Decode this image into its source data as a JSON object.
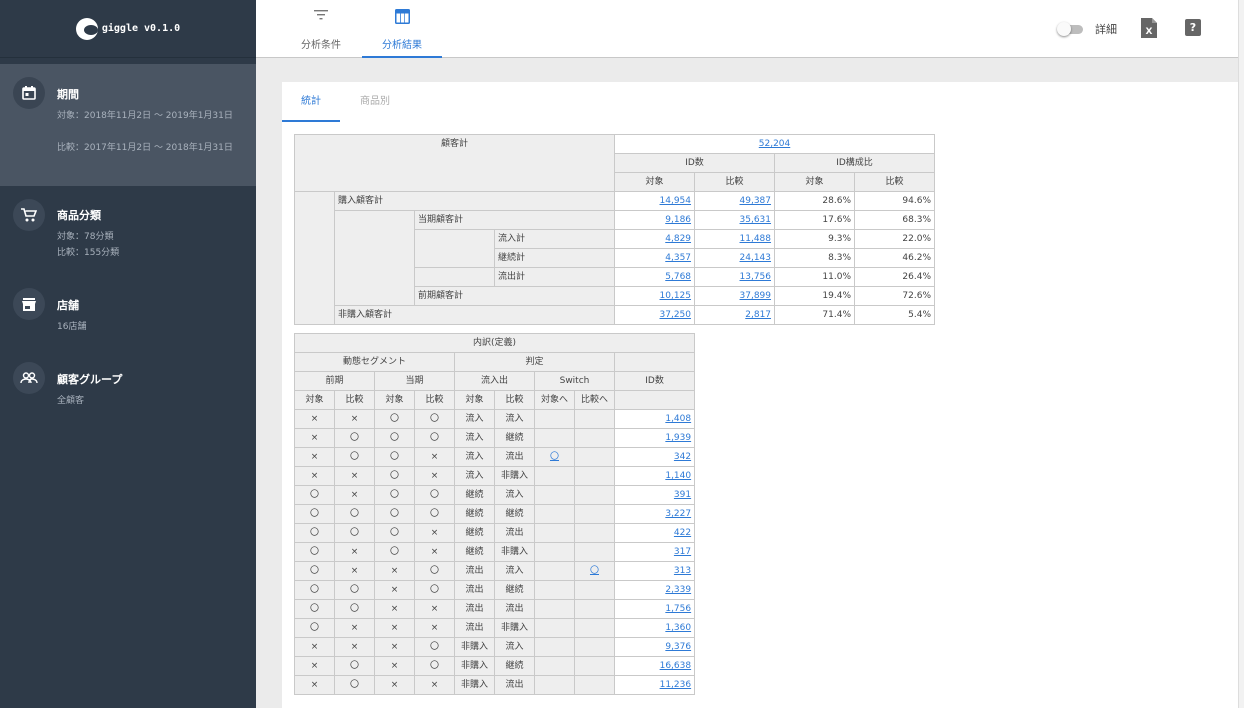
{
  "app": {
    "name": "giggle v0.1.0"
  },
  "sidebar": {
    "items": [
      {
        "title": "期間",
        "lines": [
          "対象：2018年11月2日 ～ 2019年1月31日",
          "比較：2017年11月2日 ～ 2018年1月31日"
        ]
      },
      {
        "title": "商品分類",
        "lines": [
          "対象：78分類",
          "比較：155分類"
        ]
      },
      {
        "title": "店舗",
        "lines": [
          "16店舗"
        ]
      },
      {
        "title": "顧客グループ",
        "lines": [
          "全顧客"
        ]
      }
    ]
  },
  "topbar": {
    "tabs": [
      {
        "label": "分析条件",
        "icon": "filter-icon"
      },
      {
        "label": "分析結果",
        "icon": "table-icon"
      }
    ],
    "active_tab": "分析結果",
    "detail_label": "詳細",
    "help_label": "?"
  },
  "content_tabs": [
    "統計",
    "商品別"
  ],
  "summary": {
    "total_label": "顧客計",
    "total_value": "52,204",
    "id_count_header": "ID数",
    "id_ratio_header": "ID構成比",
    "sub_headers": [
      "対象",
      "比較",
      "対象",
      "比較"
    ],
    "rows": [
      {
        "label": "購入顧客計",
        "target": "14,954",
        "compare": "49,387",
        "target_ratio": "28.6%",
        "compare_ratio": "94.6%"
      },
      {
        "label": "当期顧客計",
        "target": "9,186",
        "compare": "35,631",
        "target_ratio": "17.6%",
        "compare_ratio": "68.3%"
      },
      {
        "label": "流入計",
        "target": "4,829",
        "compare": "11,488",
        "target_ratio": "9.3%",
        "compare_ratio": "22.0%"
      },
      {
        "label": "継続計",
        "target": "4,357",
        "compare": "24,143",
        "target_ratio": "8.3%",
        "compare_ratio": "46.2%"
      },
      {
        "label": "流出計",
        "target": "5,768",
        "compare": "13,756",
        "target_ratio": "11.0%",
        "compare_ratio": "26.4%"
      },
      {
        "label": "前期顧客計",
        "target": "10,125",
        "compare": "37,899",
        "target_ratio": "19.4%",
        "compare_ratio": "72.6%"
      },
      {
        "label": "非購入顧客計",
        "target": "37,250",
        "compare": "2,817",
        "target_ratio": "71.4%",
        "compare_ratio": "5.4%"
      }
    ]
  },
  "breakdown": {
    "title": "内訳(定義)",
    "h_segment": "動態セグメント",
    "h_judge": "判定",
    "h_prev": "前期",
    "h_curr": "当期",
    "h_flow": "流入出",
    "h_switch": "Switch",
    "h_id": "ID数",
    "sub": [
      "対象",
      "比較",
      "対象",
      "比較",
      "対象",
      "比較",
      "対象へ",
      "比較へ"
    ],
    "rows": [
      {
        "cells": [
          "×",
          "×",
          "〇",
          "〇",
          "流入",
          "流入",
          "",
          ""
        ],
        "id": "1,408"
      },
      {
        "cells": [
          "×",
          "〇",
          "〇",
          "〇",
          "流入",
          "継続",
          "",
          ""
        ],
        "id": "1,939"
      },
      {
        "cells": [
          "×",
          "〇",
          "〇",
          "×",
          "流入",
          "流出",
          "〇",
          ""
        ],
        "id": "342"
      },
      {
        "cells": [
          "×",
          "×",
          "〇",
          "×",
          "流入",
          "非購入",
          "",
          ""
        ],
        "id": "1,140"
      },
      {
        "cells": [
          "〇",
          "×",
          "〇",
          "〇",
          "継続",
          "流入",
          "",
          ""
        ],
        "id": "391"
      },
      {
        "cells": [
          "〇",
          "〇",
          "〇",
          "〇",
          "継続",
          "継続",
          "",
          ""
        ],
        "id": "3,227"
      },
      {
        "cells": [
          "〇",
          "〇",
          "〇",
          "×",
          "継続",
          "流出",
          "",
          ""
        ],
        "id": "422"
      },
      {
        "cells": [
          "〇",
          "×",
          "〇",
          "×",
          "継続",
          "非購入",
          "",
          ""
        ],
        "id": "317"
      },
      {
        "cells": [
          "〇",
          "×",
          "×",
          "〇",
          "流出",
          "流入",
          "",
          "〇"
        ],
        "id": "313"
      },
      {
        "cells": [
          "〇",
          "〇",
          "×",
          "〇",
          "流出",
          "継続",
          "",
          ""
        ],
        "id": "2,339"
      },
      {
        "cells": [
          "〇",
          "〇",
          "×",
          "×",
          "流出",
          "流出",
          "",
          ""
        ],
        "id": "1,756"
      },
      {
        "cells": [
          "〇",
          "×",
          "×",
          "×",
          "流出",
          "非購入",
          "",
          ""
        ],
        "id": "1,360"
      },
      {
        "cells": [
          "×",
          "×",
          "×",
          "〇",
          "非購入",
          "流入",
          "",
          ""
        ],
        "id": "9,376"
      },
      {
        "cells": [
          "×",
          "〇",
          "×",
          "〇",
          "非購入",
          "継続",
          "",
          ""
        ],
        "id": "16,638"
      },
      {
        "cells": [
          "×",
          "〇",
          "×",
          "×",
          "非購入",
          "流出",
          "",
          ""
        ],
        "id": "11,236"
      }
    ]
  },
  "colors": {
    "sidebar_bg": "#2e3a48",
    "sidebar_active": "#4a5563",
    "accent": "#2e7ad6",
    "header_cell": "#eeeeee"
  }
}
